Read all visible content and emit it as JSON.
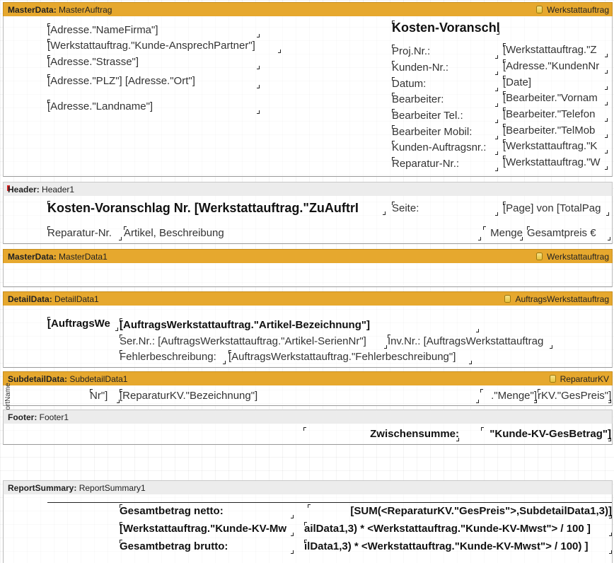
{
  "bands": {
    "masterAuftrag": {
      "type": "MasterData:",
      "name": "MasterAuftrag",
      "datasource": "Werkstattauftrag"
    },
    "header": {
      "type": "Header:",
      "name": "Header1"
    },
    "masterData1": {
      "type": "MasterData:",
      "name": "MasterData1",
      "datasource": "Werkstattauftrag"
    },
    "detailData1": {
      "type": "DetailData:",
      "name": "DetailData1",
      "datasource": "AuftragsWerkstattauftrag"
    },
    "subdetailData1": {
      "type": "SubdetailData:",
      "name": "SubdetailData1",
      "datasource": "ReparaturKV"
    },
    "footer1": {
      "type": "Footer:",
      "name": "Footer1"
    },
    "reportSummary1": {
      "type": "ReportSummary:",
      "name": "ReportSummary1"
    }
  },
  "masterAuftrag": {
    "address": [
      "[Adresse.\"NameFirma\"]",
      "[Werkstattauftrag.\"Kunde-AnsprechPartner\"]",
      "[Adresse.\"Strasse\"]",
      "[Adresse.\"PLZ\"] [Adresse.\"Ort\"]",
      "[Adresse.\"Landname\"]"
    ],
    "title": "Kosten-Voranschlag",
    "labels": [
      "Proj.Nr.:",
      "Kunden-Nr.:",
      "Datum:",
      "Bearbeiter:",
      "Bearbeiter Tel.:",
      "Bearbeiter Mobil:",
      "Kunden-Auftragsnr.:",
      "Reparatur-Nr.:"
    ],
    "values": [
      "[Werkstattauftrag.\"Z",
      "[Adresse.\"KundenNr",
      "[Date]",
      "[Bearbeiter.\"Vornam",
      "[Bearbeiter.\"Telefon",
      "[Bearbeiter.\"TelMob",
      "[Werkstattauftrag.\"K",
      "[Werkstattauftrag.\"W"
    ]
  },
  "header1": {
    "title": "Kosten-Voranschlag Nr. [Werkstattauftrag.\"ZuAuftrI",
    "seite": "Seite:",
    "page": "[Page] von [TotalPag",
    "col_reparatur": "Reparatur-Nr.",
    "col_artikel": "Artikel, Beschreibung",
    "col_menge": "Menge",
    "col_gesamt": "Gesamtpreis €"
  },
  "detailData1": {
    "auftragsWe": "[AuftragsWe",
    "artikel": "[AuftragsWerkstattauftrag.\"Artikel-Bezeichnung\"]",
    "serien": "Ser.Nr.: [AuftragsWerkstattauftrag.\"Artikel-SerienNr\"]",
    "inv": "Inv.Nr.: [AuftragsWerkstattauftrag",
    "fehler_label": "Fehlerbeschreibung:",
    "fehler_value": "[AuftragsWerkstattauftrag.\"Fehlerbeschreibung\"]"
  },
  "subdetailData1": {
    "side_label": "ReportName",
    "nr": "Nr\"]",
    "bezeichnung": "[ReparaturKV.\"Bezeichnung\"]",
    "menge": ".\"Menge\"]",
    "gespreis": "rKV.\"GesPreis\"]"
  },
  "footer1": {
    "label": "Zwischensumme:",
    "value": "\"Kunde-KV-GesBetrag\"]"
  },
  "reportSummary1": {
    "netto_label": "Gesamtbetrag netto:",
    "netto_value": "[SUM(<ReparaturKV.\"GesPreis\">,SubdetailData1,3)]",
    "mwst_label": "[Werkstattauftrag.\"Kunde-KV-Mw",
    "mwst_value": "ailData1,3) * <Werkstattauftrag.\"Kunde-KV-Mwst\"> / 100 ]",
    "brutto_label": "Gesamtbetrag brutto:",
    "brutto_value": "ilData1,3) * <Werkstattauftrag.\"Kunde-KV-Mwst\"> / 100)  ]"
  }
}
